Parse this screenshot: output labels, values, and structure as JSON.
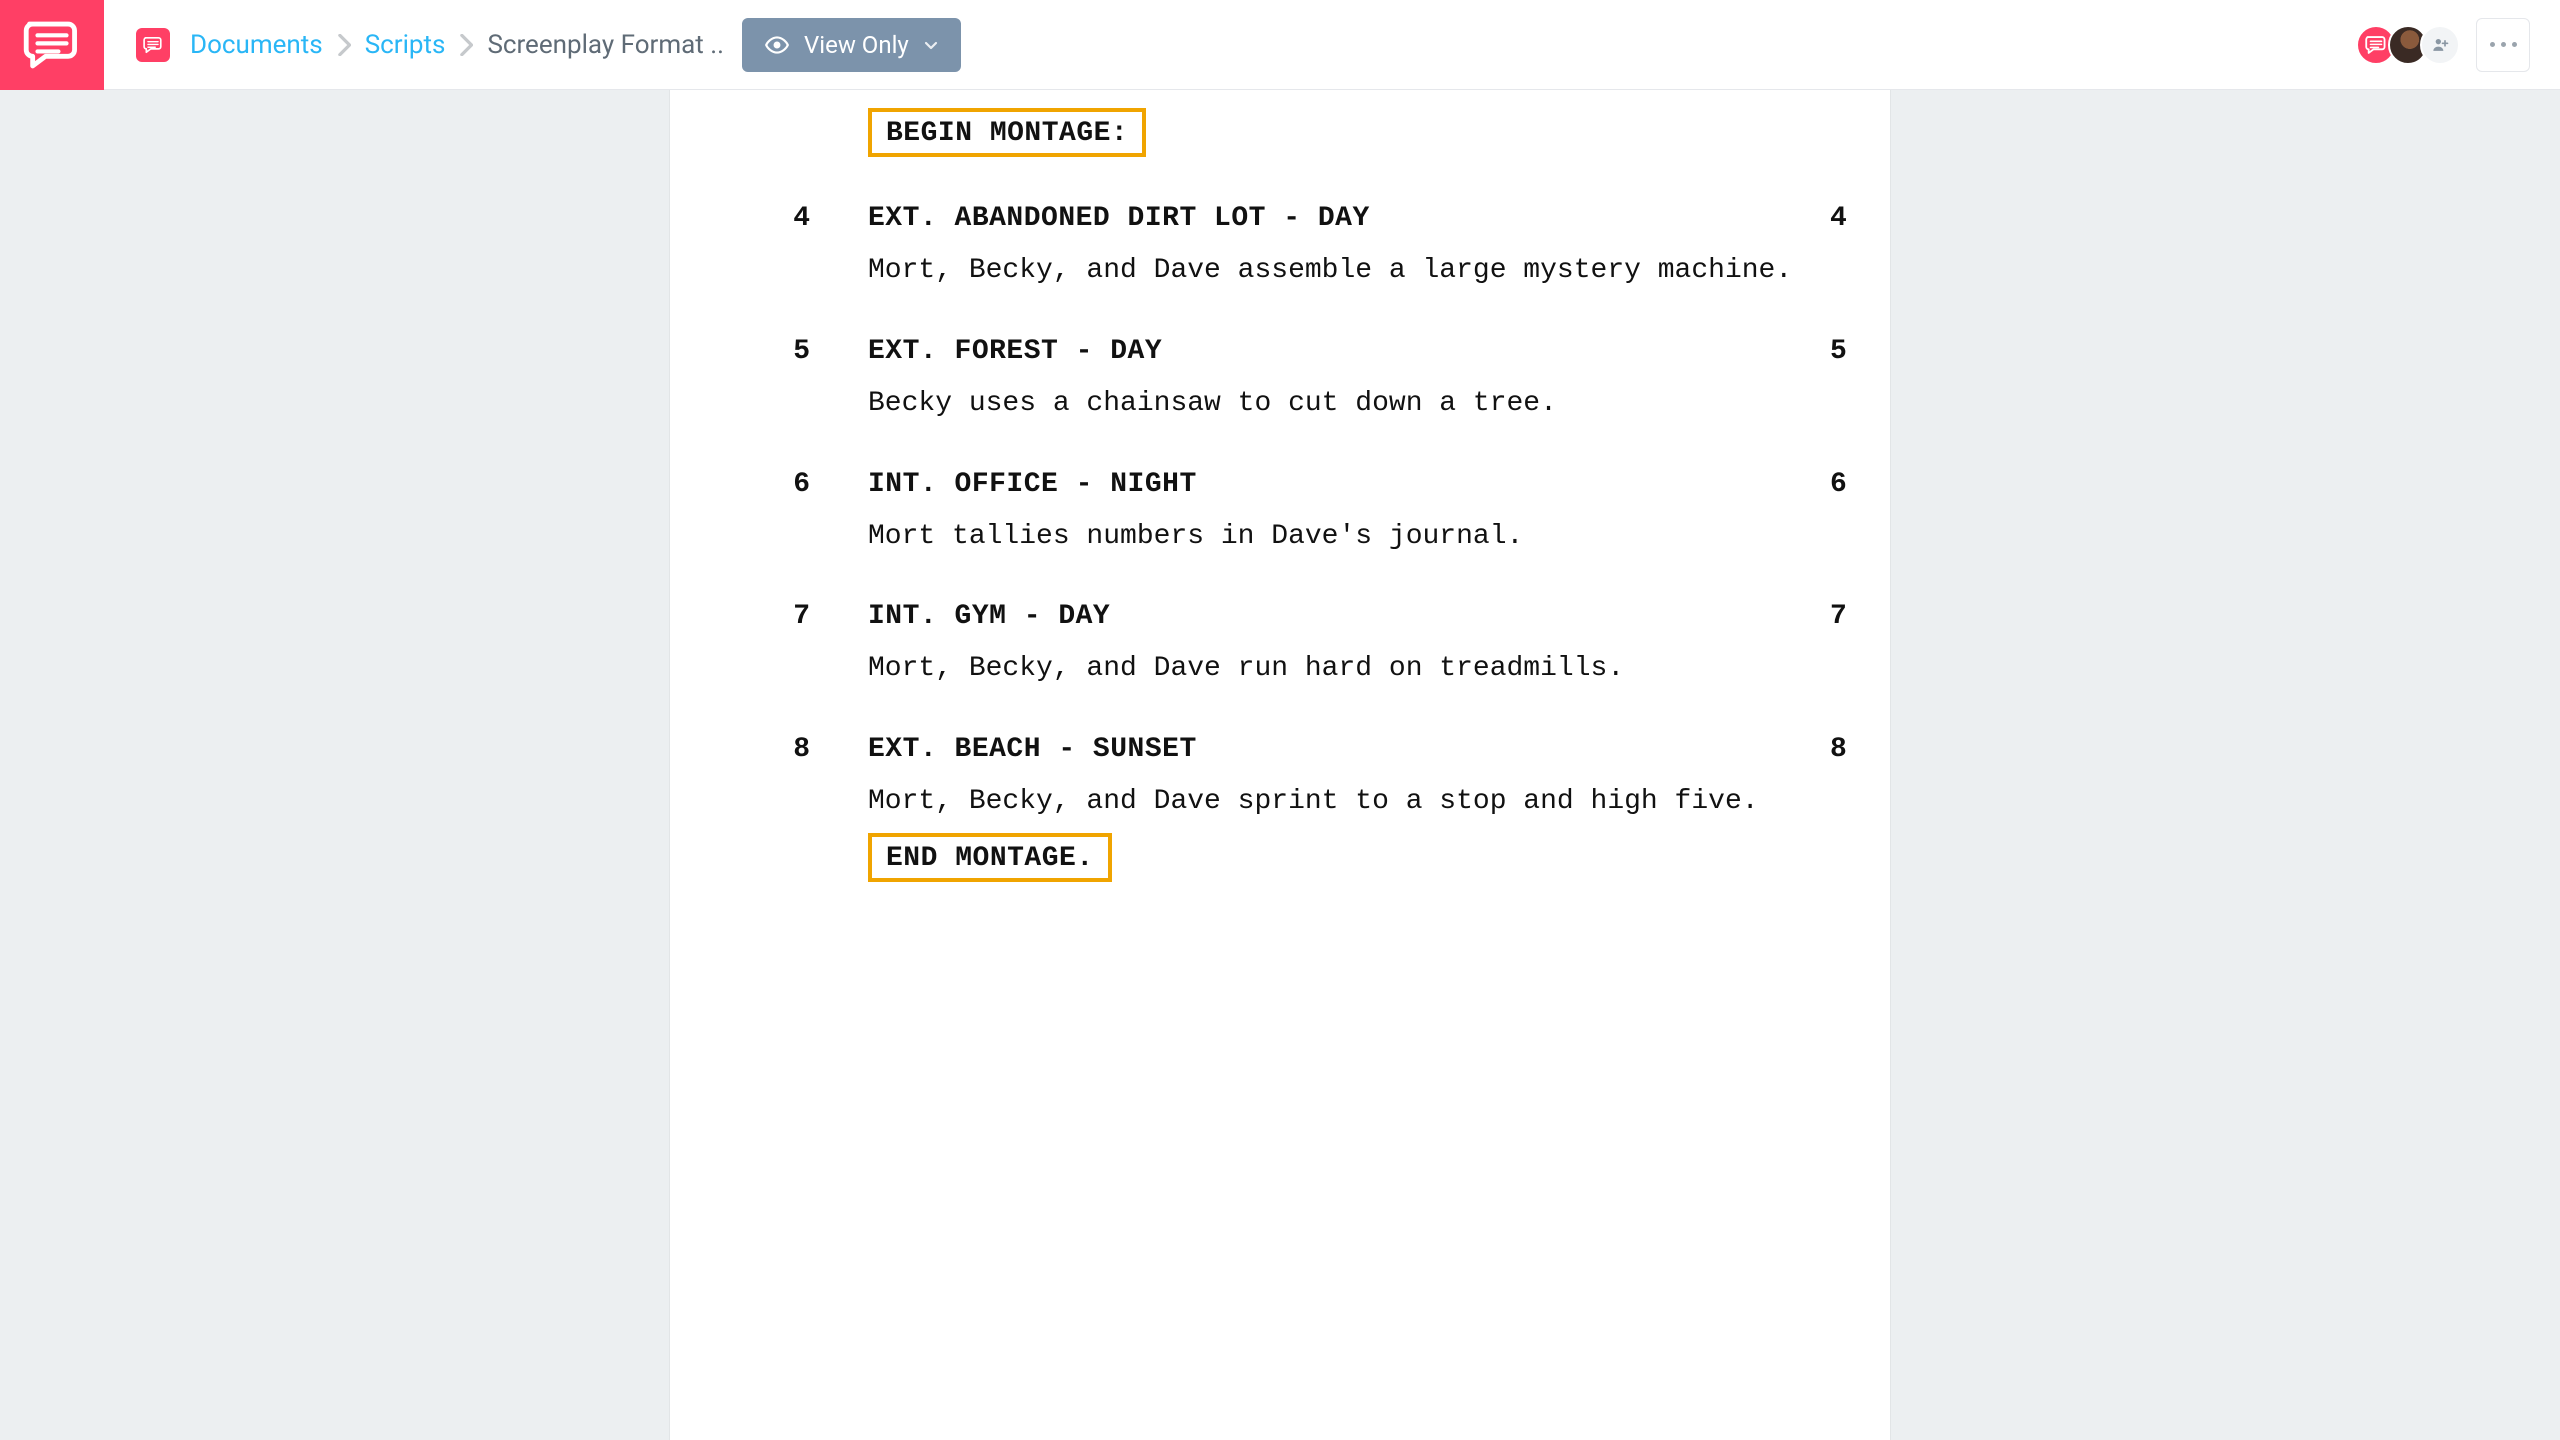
{
  "breadcrumbs": {
    "items": [
      "Documents",
      "Scripts"
    ],
    "current": "Screenplay Format .."
  },
  "view_mode": {
    "label": "View Only"
  },
  "montage": {
    "begin_label": "BEGIN MONTAGE:",
    "end_label": "END MONTAGE."
  },
  "scenes": [
    {
      "num": "4",
      "slug": "EXT. ABANDONED DIRT LOT - DAY",
      "action": "Mort, Becky, and Dave assemble a large mystery machine."
    },
    {
      "num": "5",
      "slug": "EXT. FOREST - DAY",
      "action": "Becky uses a chainsaw to cut down a tree."
    },
    {
      "num": "6",
      "slug": "INT. OFFICE - NIGHT",
      "action": "Mort tallies numbers in Dave's journal."
    },
    {
      "num": "7",
      "slug": "INT. GYM - DAY",
      "action": "Mort, Becky, and Dave run hard on treadmills."
    },
    {
      "num": "8",
      "slug": "EXT. BEACH - SUNSET",
      "action": "Mort, Becky, and Dave sprint to a stop and high five."
    }
  ]
}
